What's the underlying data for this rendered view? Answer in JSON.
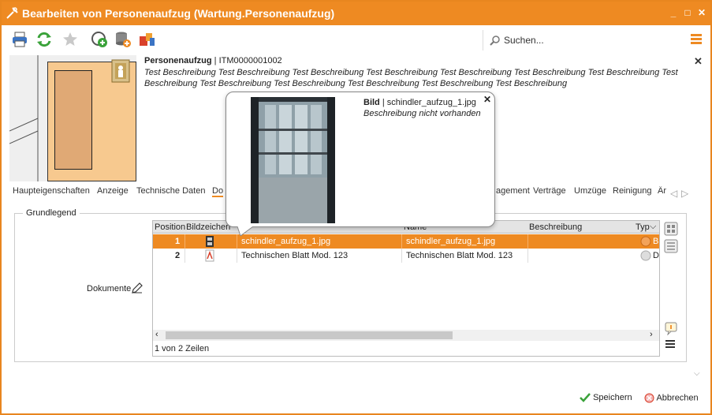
{
  "window": {
    "title": "Bearbeiten von Personenaufzug (Wartung.Personenaufzug)",
    "accent": "#ee8a22"
  },
  "toolbar": {
    "icons": [
      "print-icon",
      "refresh-icon",
      "favorite-star-icon",
      "add-circle-icon",
      "database-add-icon",
      "shapes-icon"
    ],
    "search_placeholder": "Suchen..."
  },
  "record": {
    "type": "Personenaufzug",
    "separator": "|",
    "id": "ITM0000001002",
    "description": "Test Beschreibung Test Beschreibung Test Beschreibung Test Beschreibung Test Beschreibung Test Beschreibung Test Beschreibung Test Beschreibung Test Beschreibung Test Beschreibung Test Beschreibung Test Beschreibung Test Beschreibung"
  },
  "tabs": [
    {
      "label": "Haupteigenschaften"
    },
    {
      "label": "Anzeige"
    },
    {
      "label": "Technische Daten"
    },
    {
      "label": "Do"
    },
    {
      "label": "agement"
    },
    {
      "label": "Verträge"
    },
    {
      "label": "Umzüge"
    },
    {
      "label": "Reinigung"
    },
    {
      "label": "Är"
    }
  ],
  "section": {
    "legend": "Grundlegend",
    "documents_label": "Dokumente"
  },
  "grid": {
    "columns": [
      "Position",
      "Bildzeichen",
      "",
      "Name",
      "Beschreibung",
      "Typ"
    ],
    "rows": [
      {
        "position": "1",
        "col3": "schindler_aufzug_1.jpg",
        "name": "schindler_aufzug_1.jpg",
        "description": "",
        "type": "B",
        "selected": true
      },
      {
        "position": "2",
        "col3": "Technischen Blatt Mod. 123",
        "name": "Technischen Blatt Mod. 123",
        "description": "",
        "type": "D",
        "selected": false
      }
    ],
    "row_count": "1 von 2 Zeilen"
  },
  "popup": {
    "label": "Bild",
    "separator": "|",
    "filename": "schindler_aufzug_1.jpg",
    "description": "Beschreibung nicht vorhanden"
  },
  "footer": {
    "save_label": "Speichern",
    "cancel_label": "Abbrechen"
  }
}
